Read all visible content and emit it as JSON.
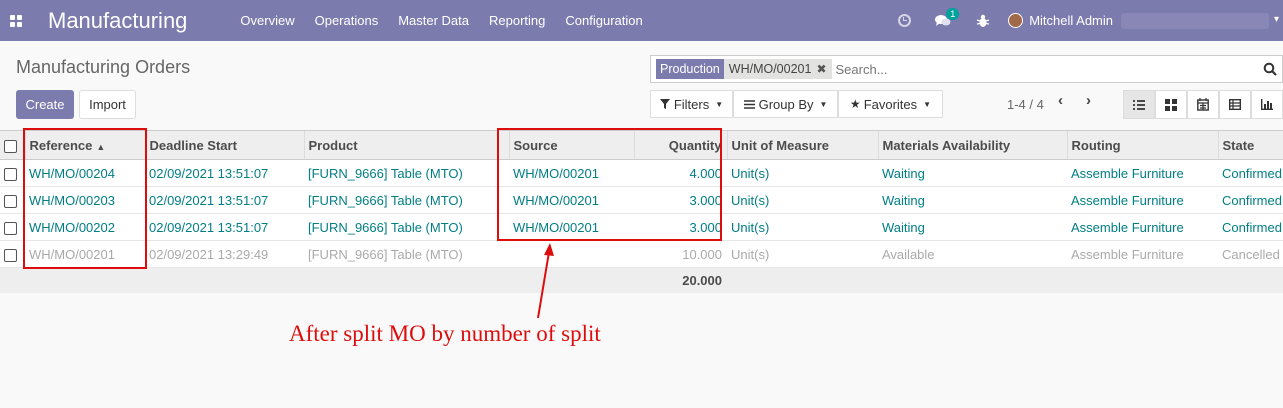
{
  "navbar": {
    "app_name": "Manufacturing",
    "menu": [
      "Overview",
      "Operations",
      "Master Data",
      "Reporting",
      "Configuration"
    ],
    "chat_badge": "1",
    "user_name": "Mitchell Admin",
    "colors": {
      "bar": "#7c7bad"
    }
  },
  "control_panel": {
    "title": "Manufacturing Orders",
    "create_label": "Create",
    "import_label": "Import",
    "facet_category": "Production",
    "facet_value": "WH/MO/00201",
    "search_placeholder": "Search...",
    "filters_label": "Filters",
    "groupby_label": "Group By",
    "favorites_label": "Favorites",
    "pager": "1-4 / 4"
  },
  "table": {
    "columns": [
      "Reference",
      "Deadline Start",
      "Product",
      "Source",
      "Quantity",
      "Unit of Measure",
      "Materials Availability",
      "Routing",
      "State"
    ],
    "rows": [
      {
        "ref": "WH/MO/00204",
        "deadline": "02/09/2021 13:51:07",
        "product": "[FURN_9666] Table (MTO)",
        "source": "WH/MO/00201",
        "qty": "4.000",
        "uom": "Unit(s)",
        "avail": "Waiting",
        "routing": "Assemble Furniture",
        "state": "Confirmed"
      },
      {
        "ref": "WH/MO/00203",
        "deadline": "02/09/2021 13:51:07",
        "product": "[FURN_9666] Table (MTO)",
        "source": "WH/MO/00201",
        "qty": "3.000",
        "uom": "Unit(s)",
        "avail": "Waiting",
        "routing": "Assemble Furniture",
        "state": "Confirmed"
      },
      {
        "ref": "WH/MO/00202",
        "deadline": "02/09/2021 13:51:07",
        "product": "[FURN_9666] Table (MTO)",
        "source": "WH/MO/00201",
        "qty": "3.000",
        "uom": "Unit(s)",
        "avail": "Waiting",
        "routing": "Assemble Furniture",
        "state": "Confirmed"
      },
      {
        "ref": "WH/MO/00201",
        "deadline": "02/09/2021 13:29:49",
        "product": "[FURN_9666] Table (MTO)",
        "source": "",
        "qty": "10.000",
        "uom": "Unit(s)",
        "avail": "Available",
        "routing": "Assemble Furniture",
        "state": "Cancelled"
      }
    ],
    "total_qty": "20.000"
  },
  "annotation": {
    "text": "After split MO by number of split",
    "color": "#dd0d0d"
  }
}
